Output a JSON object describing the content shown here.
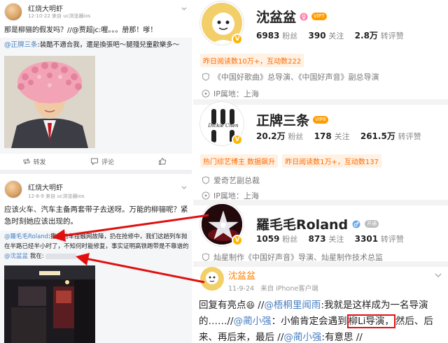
{
  "left": {
    "post1": {
      "nickname": "红烧大明虾",
      "time": "12-10-22",
      "source": "来自 uc浏览器ios",
      "text": "那是柳骊的假发吗？//@贾超jc:喔。。。册那！嗲！",
      "repost_user": "@正牌三条",
      "repost_text": ":装酷不適合我，還是換張吧～腿殘兒童歡樂多～",
      "actions": {
        "repost": "转发",
        "comment": "评论",
        "like": ""
      }
    },
    "post2": {
      "nickname": "红烧大明虾",
      "time": "12-8-9",
      "source": "来自 uc浏览器ios",
      "text": "应该火车、汽车主备两套带子去送呀。万能的柳骊呢？紧急时刻她应该出现的。",
      "repost_user": "@羅毛毛Roland",
      "repost_text": ":撒说前车接触网故障，扔在抢修中，我们这趟列车抛在半路已经半小时了，不知何时能修复，事实证明高铁跑带是不靠谱的",
      "repost_mention": "@沈盆盆",
      "repost_tail": " 我在:"
    }
  },
  "right": {
    "profile1": {
      "name": "沈盆盆",
      "vip": "VIP7",
      "fans": "6983",
      "fans_unit": "粉丝",
      "follow": "390",
      "follow_unit": "关注",
      "likes": "2.8万",
      "likes_unit": "转评赞",
      "tag": "昨日阅读数10万+，互动数222",
      "info1": "《中国好歌曲》总导演、《中国好声音》副总导演",
      "info2": "IP属地：上海"
    },
    "profile2": {
      "name": "正牌三条",
      "avatar_text": "Dickie Chen",
      "vip": "VIP8",
      "fans": "20.2万",
      "fans_unit": "粉丝",
      "follow": "178",
      "follow_unit": "关注",
      "likes": "261.5万",
      "likes_unit": "转评赞",
      "tags": [
        "热门综艺博主 数据飙升",
        "昨日阅读数1万+，互动数137"
      ],
      "info1": "爱奇艺副总裁",
      "info2": "IP属地：上海"
    },
    "profile3": {
      "name": "羅毛毛Roland",
      "vip": "开通",
      "fans": "1059",
      "fans_unit": "粉丝",
      "follow": "873",
      "follow_unit": "关注",
      "likes": "3301",
      "likes_unit": "转评赞",
      "info1": "灿星制作《中国好声音》导演、灿星制作技术总监"
    },
    "post": {
      "nickname": "沈盆盆",
      "time": "11-9-24",
      "source": "来自 iPhone客户端",
      "text_a": "回复有亮点",
      "text_b": " //",
      "mention1": "@梧桐里闻雨",
      "text_c": ":我就是这样成为一名导演的……//",
      "mention2": "@蔺小强",
      "text_d": "：小偷肯定会遇到",
      "highlight": "柳Li导演，",
      "text_e": "然后、后来、再后来，最后 //",
      "mention3": "@蔺小强",
      "text_f": ":有意思 //"
    }
  },
  "colors": {
    "arrow": "#e01010",
    "link": "#4a7fc0",
    "orange": "#ff8200",
    "verified": "#ffb400"
  }
}
